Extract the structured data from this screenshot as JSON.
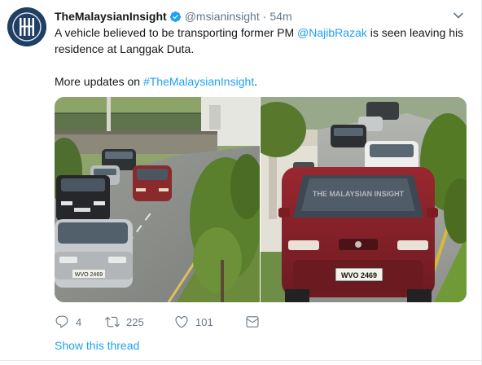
{
  "tweet": {
    "display_name": "TheMalaysianInsight",
    "handle": "@msianinsight",
    "separator": "·",
    "time": "54m",
    "text_line1_a": "A vehicle believed to be transporting former PM ",
    "mention_at": "@",
    "mention_name": "NajibRazak",
    "text_line1_b": " is seen leaving his",
    "text_line2": "residence at Langgak Duta.",
    "text_line3_a": "More updates on ",
    "hashtag": "#TheMalaysianInsight",
    "text_line3_b": ".",
    "plate_left": "WVO 2469",
    "plate_right": "WVO 2469",
    "watermark": "THE MALAYSIAN INSIGHT"
  },
  "actions": {
    "reply_count": "4",
    "retweet_count": "225",
    "like_count": "101"
  },
  "show_thread": "Show this thread",
  "icons": {
    "avatar": "malaysian-insight-logo",
    "verified": "verified-badge-icon",
    "caret": "chevron-down-icon",
    "reply": "reply-icon",
    "retweet": "retweet-icon",
    "like": "heart-icon",
    "dm": "envelope-icon"
  },
  "colors": {
    "link": "#1da1f2",
    "muted": "#657786",
    "text": "#14171a",
    "avatar_bg": "#1f3f66"
  }
}
